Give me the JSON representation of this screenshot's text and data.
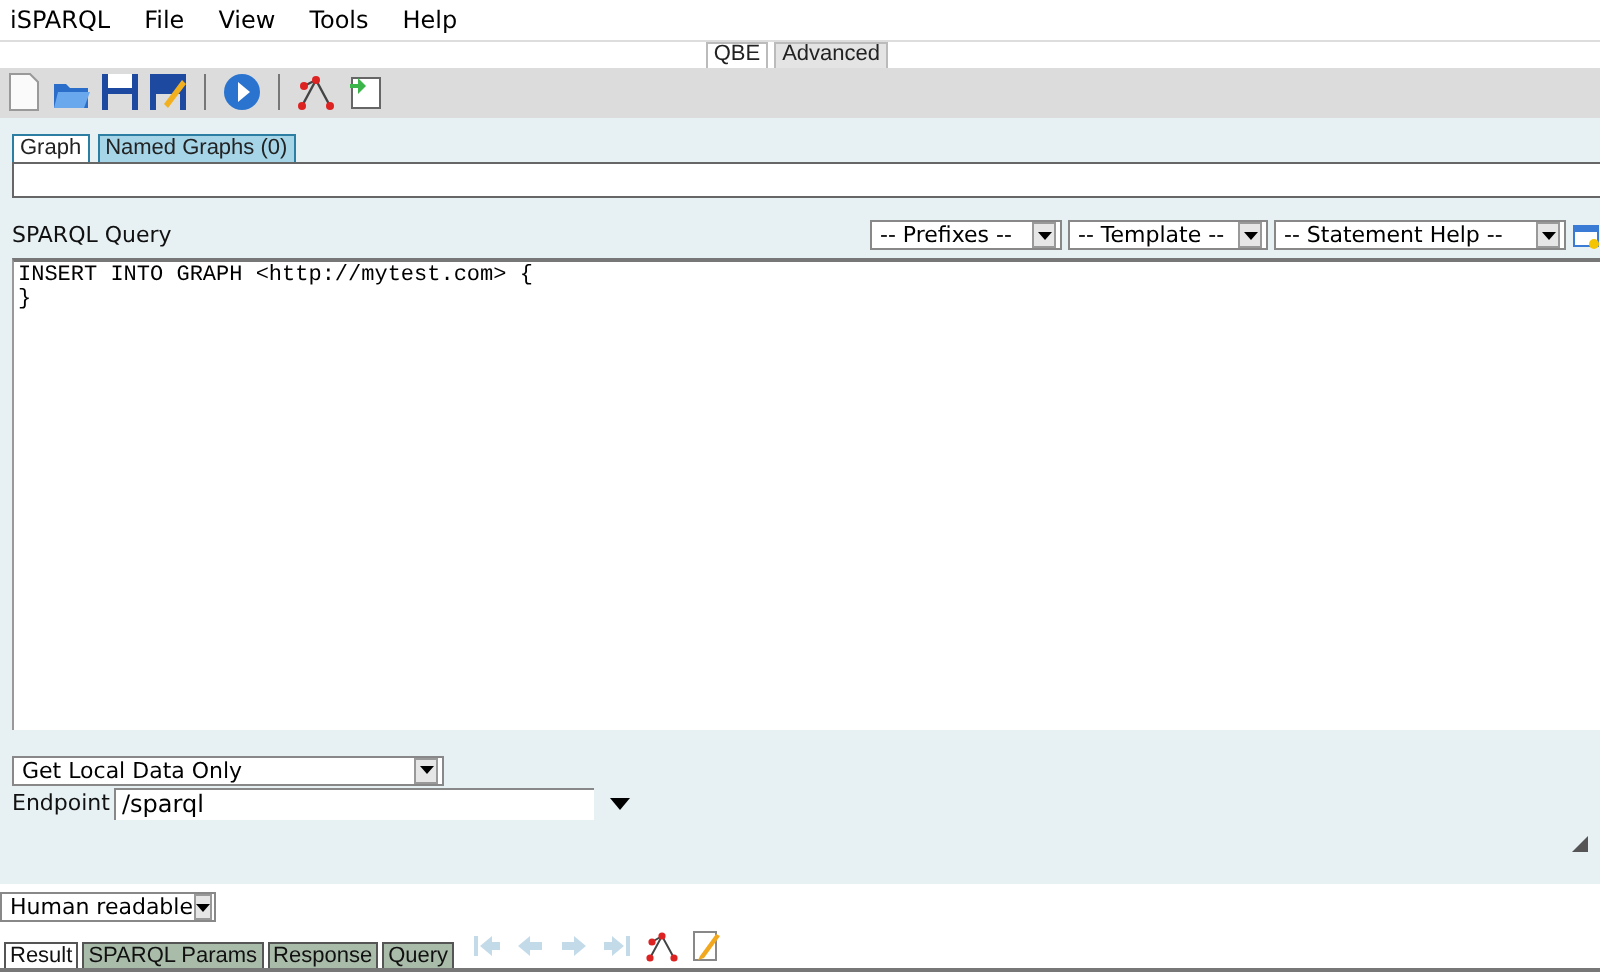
{
  "menu_bar": {
    "items": [
      "iSPARQL",
      "File",
      "View",
      "Tools",
      "Help"
    ]
  },
  "mode_tabs": [
    {
      "label": "QBE",
      "selected": true
    },
    {
      "label": "Advanced",
      "selected": false
    }
  ],
  "toolbar": {
    "items": [
      {
        "kind": "new"
      },
      {
        "kind": "open"
      },
      {
        "kind": "save"
      },
      {
        "kind": "save-as"
      },
      {
        "kind": "separator"
      },
      {
        "kind": "run"
      },
      {
        "kind": "separator"
      },
      {
        "kind": "graph"
      },
      {
        "kind": "load"
      }
    ]
  },
  "graph_tabs": [
    {
      "label": "Graph",
      "selected": true
    },
    {
      "label": "Named Graphs (0)",
      "selected": false
    }
  ],
  "query": {
    "label": "SPARQL Query",
    "selects": [
      "-- Prefixes --",
      "-- Template --",
      "-- Statement Help --"
    ],
    "text": "INSERT INTO GRAPH <http://mytest.com> {\n}"
  },
  "data_source": {
    "value": "Get Local Data Only"
  },
  "endpoint": {
    "label": "Endpoint",
    "value": "/sparql"
  },
  "result_format": {
    "value": "Human readable"
  },
  "result_tabs": [
    {
      "label": "Result",
      "selected": true
    },
    {
      "label": "SPARQL Params",
      "selected": false
    },
    {
      "label": "Response",
      "selected": false
    },
    {
      "label": "Query",
      "selected": false
    }
  ],
  "result_tools": [
    {
      "kind": "first",
      "disabled": true
    },
    {
      "kind": "prev",
      "disabled": true
    },
    {
      "kind": "next",
      "disabled": true
    },
    {
      "kind": "last",
      "disabled": true
    },
    {
      "kind": "graph",
      "disabled": false
    },
    {
      "kind": "edit",
      "disabled": false
    }
  ]
}
